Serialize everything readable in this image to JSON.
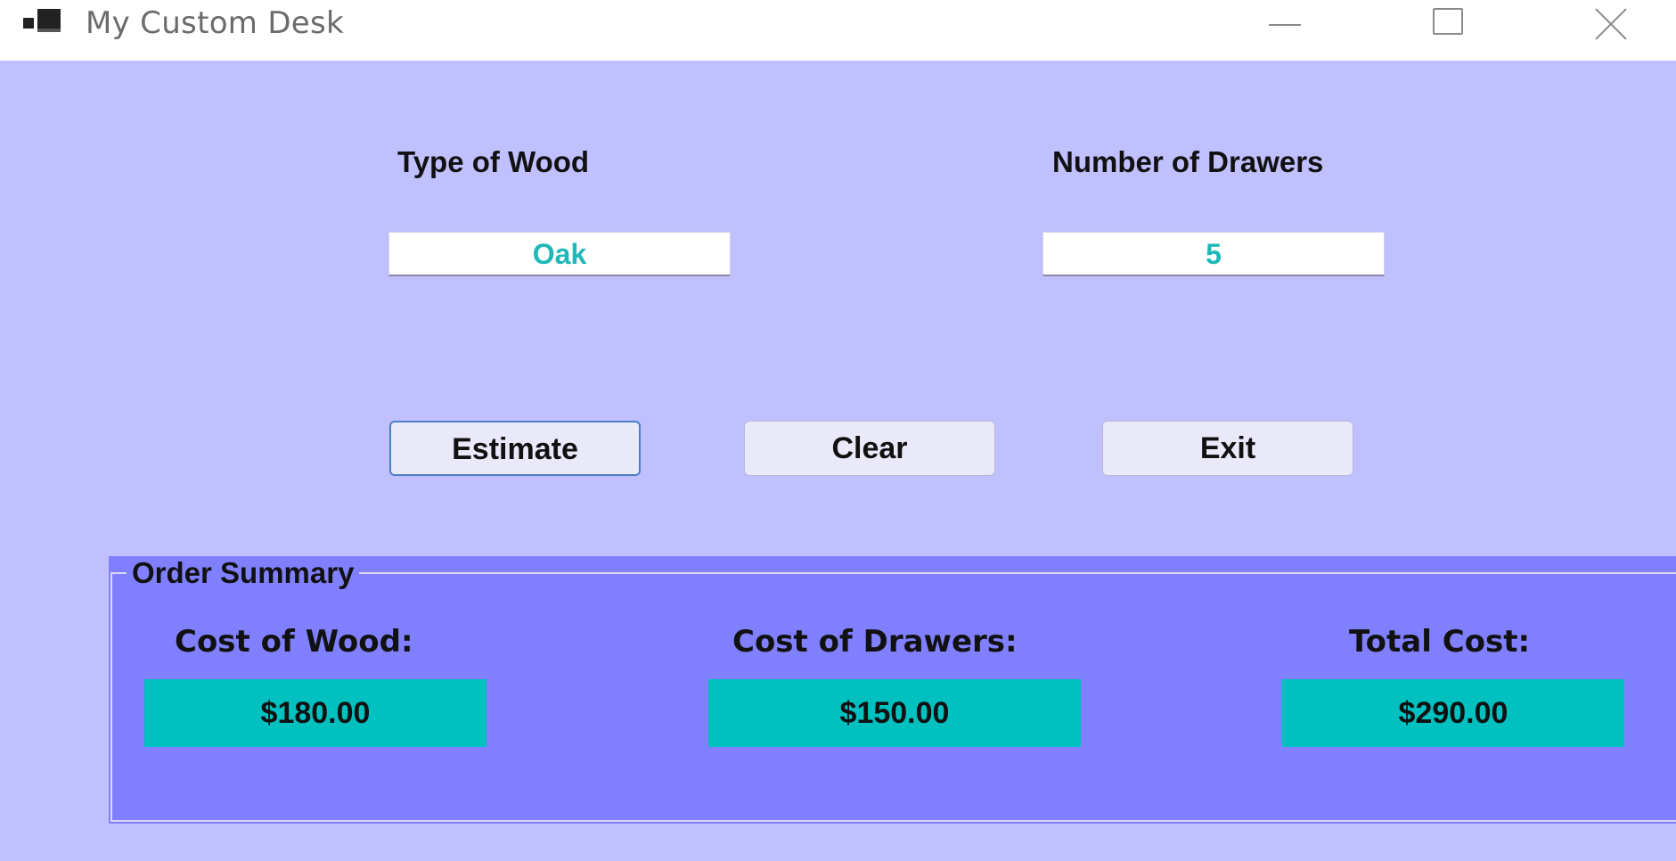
{
  "window": {
    "title": "My Custom Desk",
    "icon": "app-window-icon",
    "controls": [
      "minimize-icon",
      "maximize-icon",
      "close-icon"
    ]
  },
  "inputs": {
    "wood_label": "Type of Wood",
    "wood_value": "Oak",
    "drawers_label": "Number of Drawers",
    "drawers_value": "5"
  },
  "buttons": {
    "estimate": "Estimate",
    "clear": "Clear",
    "exit": "Exit"
  },
  "summary": {
    "title": "Order Summary",
    "cost_of_wood_label": "Cost of Wood:",
    "cost_of_wood_value": "$180.00",
    "cost_of_drawers_label": "Cost of Drawers:",
    "cost_of_drawers_value": "$150.00",
    "total_cost_label": "Total Cost:",
    "total_cost_value": "$290.00"
  },
  "colors": {
    "form_background": "#C0C0FF",
    "summary_background": "#8080FF",
    "value_box": "#00C0C0",
    "input_text": "#1EB8B8"
  }
}
